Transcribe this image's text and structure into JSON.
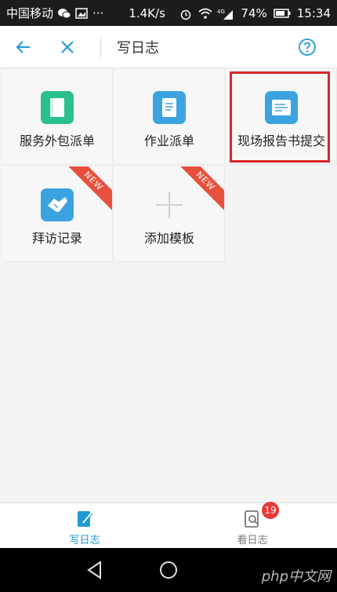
{
  "status_bar": {
    "carrier": "中国移动",
    "speed": "1.4K/s",
    "signal_label": "4G",
    "battery": "74%",
    "time": "15:34",
    "icons": [
      "wechat-icon",
      "image-icon",
      "more-dots-icon",
      "alarm-icon",
      "wifi-icon",
      "signal-icon",
      "battery-icon"
    ]
  },
  "app_bar": {
    "title": "写日志",
    "back_icon": "arrow-left-icon",
    "close_icon": "close-icon",
    "help_icon": "question-circle-icon"
  },
  "templates": [
    {
      "label": "服务外包派单",
      "icon": "document-green-icon",
      "icon_color": "#2bbf8f",
      "badge": ""
    },
    {
      "label": "作业派单",
      "icon": "document-blue-icon",
      "icon_color": "#3da3e0",
      "badge": ""
    },
    {
      "label": "现场报告书提交",
      "icon": "report-blue-icon",
      "icon_color": "#3da3e0",
      "badge": "",
      "highlighted": true
    },
    {
      "label": "拜访记录",
      "icon": "handshake-icon",
      "icon_color": "#3da3e0",
      "badge": "NEW"
    },
    {
      "label": "添加模板",
      "icon": "plus-icon",
      "icon_color": "#cfcfcf",
      "badge": "NEW"
    }
  ],
  "bottom_nav": {
    "items": [
      {
        "label": "写日志",
        "icon": "write-log-icon",
        "active": true
      },
      {
        "label": "看日志",
        "icon": "search-log-icon",
        "active": false,
        "count": "19"
      }
    ],
    "active_color": "#1f9ad6",
    "inactive_color": "#777777"
  },
  "android_nav": {
    "icons": [
      "back-triangle-icon",
      "home-circle-icon"
    ]
  },
  "watermark": "php中文网",
  "colors": {
    "accent": "#1f9ad6",
    "highlight": "#d8262a",
    "new_badge": "#e8503e"
  }
}
